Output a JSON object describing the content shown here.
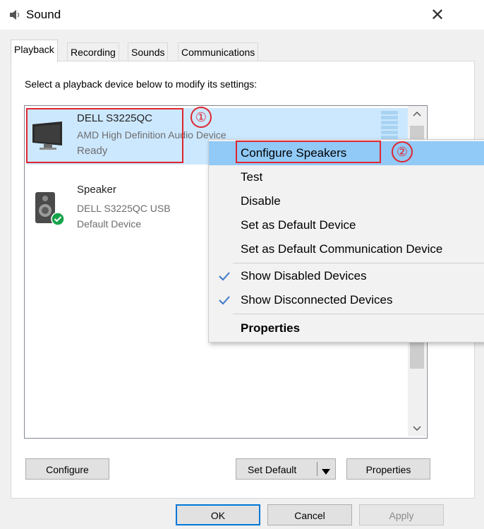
{
  "window": {
    "title": "Sound",
    "close_glyph": "✕"
  },
  "tabs": [
    {
      "label": "Playback",
      "active": true
    },
    {
      "label": "Recording",
      "active": false
    },
    {
      "label": "Sounds",
      "active": false
    },
    {
      "label": "Communications",
      "active": false
    }
  ],
  "instruction": "Select a playback device below to modify its settings:",
  "devices": [
    {
      "name": "DELL S3225QC",
      "driver": "AMD High Definition Audio Device",
      "status": "Ready",
      "selected": true,
      "icon": "monitor-icon"
    },
    {
      "name": "Speaker",
      "driver": "DELL S3225QC USB",
      "status": "Default Device",
      "selected": false,
      "icon": "speaker-icon",
      "badge": "default-check-icon"
    }
  ],
  "context_menu": {
    "items": [
      {
        "label": "Configure Speakers",
        "highlighted": true
      },
      {
        "label": "Test"
      },
      {
        "label": "Disable"
      },
      {
        "label": "Set as Default Device"
      },
      {
        "label": "Set as Default Communication Device"
      },
      {
        "label": "Show Disabled Devices",
        "checked": true
      },
      {
        "label": "Show Disconnected Devices",
        "checked": true
      },
      {
        "label": "Properties",
        "bold": true
      }
    ]
  },
  "annotations": {
    "step1": "①",
    "step2": "②",
    "color": "#e0262e"
  },
  "buttons": {
    "configure": "Configure",
    "set_default": "Set Default",
    "properties": "Properties",
    "ok": "OK",
    "cancel": "Cancel",
    "apply": "Apply"
  },
  "colors": {
    "selection": "#cce8ff",
    "menu_highlight": "#91c9f7",
    "checkmark": "#3c78c8",
    "default_badge": "#15a34a"
  }
}
